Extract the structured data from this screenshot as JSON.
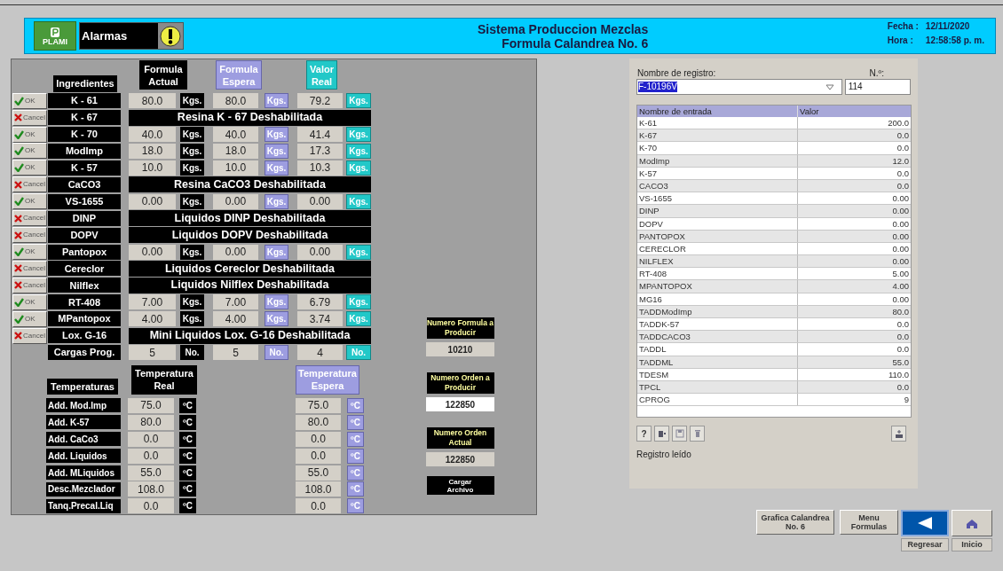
{
  "header": {
    "logo": "PLAMI",
    "alarm_label": "Alarmas",
    "title_lines": [
      "Sistema Produccion Mezclas",
      "Formula Calandrea No. 6"
    ],
    "date_label": "Fecha :",
    "date": "12/11/2020",
    "time_label": "Hora :",
    "time": "12:58:58 p. m."
  },
  "ingredients": {
    "columns": [
      "Ingredientes",
      "Formula Actual",
      "Formula Espera",
      "Valor Real"
    ],
    "rows": [
      {
        "name": "K - 61",
        "enabled": true,
        "button": "OK",
        "actual": "80.0",
        "actual_unit": "Kgs.",
        "espera": "80.0",
        "espera_unit": "Kgs.",
        "real": "79.2",
        "real_unit": "Kgs."
      },
      {
        "name": "K - 67",
        "enabled": false,
        "button": "Cancel",
        "message": "Resina K - 67 Deshabilitada"
      },
      {
        "name": "K - 70",
        "enabled": true,
        "button": "OK",
        "actual": "40.0",
        "actual_unit": "Kgs.",
        "espera": "40.0",
        "espera_unit": "Kgs.",
        "real": "41.4",
        "real_unit": "Kgs."
      },
      {
        "name": "ModImp",
        "enabled": true,
        "button": "OK",
        "actual": "18.0",
        "actual_unit": "Kgs.",
        "espera": "18.0",
        "espera_unit": "Kgs.",
        "real": "17.3",
        "real_unit": "Kgs."
      },
      {
        "name": "K - 57",
        "enabled": true,
        "button": "OK",
        "actual": "10.0",
        "actual_unit": "Kgs.",
        "espera": "10.0",
        "espera_unit": "Kgs.",
        "real": "10.3",
        "real_unit": "Kgs."
      },
      {
        "name": "CaCO3",
        "enabled": false,
        "button": "Cancel",
        "message": "Resina CaCO3 Deshabilitada"
      },
      {
        "name": "VS-1655",
        "enabled": true,
        "button": "OK",
        "actual": "0.00",
        "actual_unit": "Kgs.",
        "espera": "0.00",
        "espera_unit": "Kgs.",
        "real": "0.00",
        "real_unit": "Kgs."
      },
      {
        "name": "DINP",
        "enabled": false,
        "button": "Cancel",
        "message": "Liquidos DINP Deshabilitada"
      },
      {
        "name": "DOPV",
        "enabled": false,
        "button": "Cancel",
        "message": "Liquidos DOPV Deshabilitada"
      },
      {
        "name": "Pantopox",
        "enabled": true,
        "button": "OK",
        "actual": "0.00",
        "actual_unit": "Kgs.",
        "espera": "0.00",
        "espera_unit": "Kgs.",
        "real": "0.00",
        "real_unit": "Kgs."
      },
      {
        "name": "Cereclor",
        "enabled": false,
        "button": "Cancel",
        "message": "Liquidos Cereclor Deshabilitada"
      },
      {
        "name": "Nilflex",
        "enabled": false,
        "button": "Cancel",
        "message": "Liquidos Nilflex Deshabilitada"
      },
      {
        "name": "RT-408",
        "enabled": true,
        "button": "OK",
        "actual": "7.00",
        "actual_unit": "Kgs.",
        "espera": "7.00",
        "espera_unit": "Kgs.",
        "real": "6.79",
        "real_unit": "Kgs."
      },
      {
        "name": "MPantopox",
        "enabled": true,
        "button": "OK",
        "actual": "4.00",
        "actual_unit": "Kgs.",
        "espera": "4.00",
        "espera_unit": "Kgs.",
        "real": "3.74",
        "real_unit": "Kgs."
      },
      {
        "name": "Lox. G-16",
        "enabled": false,
        "button": "Cancel",
        "message": "Mini Liquidos Lox. G-16 Deshabilitada"
      }
    ]
  },
  "cargas": {
    "name": "Cargas Prog.",
    "actual": "5",
    "actual_unit": "No.",
    "espera": "5",
    "espera_unit": "No.",
    "real": "4",
    "real_unit": "No."
  },
  "temperatures": {
    "columns": [
      "Temperaturas",
      "Temperatura Real",
      "Temperatura Espera"
    ],
    "rows": [
      {
        "name": "Add. Mod.Imp",
        "real": "75.0",
        "real_unit": "ºC",
        "espera": "75.0",
        "espera_unit": "ºC"
      },
      {
        "name": "Add. K-57",
        "real": "80.0",
        "real_unit": "ºC",
        "espera": "80.0",
        "espera_unit": "ºC"
      },
      {
        "name": "Add. CaCo3",
        "real": "0.0",
        "real_unit": "ºC",
        "espera": "0.0",
        "espera_unit": "ºC"
      },
      {
        "name": "Add. Liquidos",
        "real": "0.0",
        "real_unit": "ºC",
        "espera": "0.0",
        "espera_unit": "ºC"
      },
      {
        "name": "Add. MLiquidos",
        "real": "55.0",
        "real_unit": "ºC",
        "espera": "55.0",
        "espera_unit": "ºC"
      },
      {
        "name": "Desc.Mezclador",
        "real": "108.0",
        "real_unit": "ºC",
        "espera": "108.0",
        "espera_unit": "ºC"
      },
      {
        "name": "Tanq.Precal.Liq",
        "real": "0.0",
        "real_unit": "ºC",
        "espera": "0.0",
        "espera_unit": "ºC"
      }
    ]
  },
  "production": [
    {
      "label": "Numero Formula a Producir",
      "value": "10210",
      "editable": false
    },
    {
      "label": "Numero Orden a Producir",
      "value": "122850",
      "editable": true
    },
    {
      "label": "Numero Orden Actual",
      "value": "122850",
      "editable": false
    }
  ],
  "load_button": "Cargar Archivo",
  "registry": {
    "name_label": "Nombre de registro:",
    "name_value": "F-10196V",
    "number_label": "N.º:",
    "number_value": "114",
    "columns": [
      "Nombre de entrada",
      "Valor"
    ],
    "rows": [
      [
        "K-61",
        "200.0"
      ],
      [
        "K-67",
        "0.0"
      ],
      [
        "K-70",
        "0.0"
      ],
      [
        "ModImp",
        "12.0"
      ],
      [
        "K-57",
        "0.0"
      ],
      [
        "CACO3",
        "0.0"
      ],
      [
        "VS-1655",
        "0.00"
      ],
      [
        "DINP",
        "0.00"
      ],
      [
        "DOPV",
        "0.00"
      ],
      [
        "PANTOPOX",
        "0.00"
      ],
      [
        "CERECLOR",
        "0.00"
      ],
      [
        "NILFLEX",
        "0.00"
      ],
      [
        "RT-408",
        "5.00"
      ],
      [
        "MPANTOPOX",
        "4.00"
      ],
      [
        "MG16",
        "0.00"
      ],
      [
        "TADDModImp",
        "80.0"
      ],
      [
        "TADDK-57",
        "0.0"
      ],
      [
        "TADDCACO3",
        "0.0"
      ],
      [
        "TADDL",
        "0.0"
      ],
      [
        "TADDML",
        "55.0"
      ],
      [
        "TDESM",
        "110.0"
      ],
      [
        "TPCL",
        "0.0"
      ],
      [
        "CPROG",
        "9"
      ]
    ],
    "help_button": "?",
    "status": "Registro leído"
  },
  "nav": {
    "buttons": [
      "Grafica Calandrea No. 6",
      "Menu Formulas"
    ],
    "back_label": "Regresar",
    "home_label": "Inicio"
  }
}
